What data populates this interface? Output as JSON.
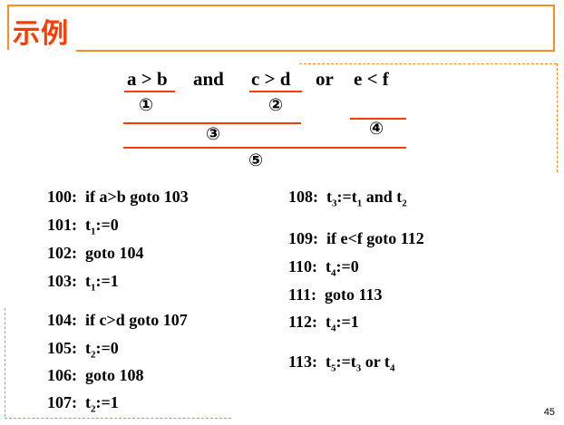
{
  "title": "示例",
  "expression": {
    "a": "a > b",
    "and": "and",
    "c": "c > d",
    "or": "or",
    "e": "e < f"
  },
  "markers": [
    "①",
    "②",
    "③",
    "④",
    "⑤"
  ],
  "code_left": [
    {
      "label": "100:",
      "text": "if  a>b  goto  103"
    },
    {
      "label": "101:",
      "pre": "t",
      "sub": "1",
      "post": ":=0"
    },
    {
      "label": "102:",
      "text": "goto  104"
    },
    {
      "label": "103:",
      "pre": "t",
      "sub": "1",
      "post": ":=1"
    },
    {
      "label": "104:",
      "text": "if  c>d  goto  107"
    },
    {
      "label": "105:",
      "pre": "t",
      "sub": "2",
      "post": ":=0"
    },
    {
      "label": "106:",
      "text": "goto  108"
    },
    {
      "label": "107:",
      "pre": "t",
      "sub": "2",
      "post": ":=1"
    }
  ],
  "code_right": [
    {
      "label": "108:",
      "t1": "t",
      "s1": "3",
      "m1": ":=t",
      "s2": "1",
      "m2": " and t",
      "s3": "2"
    },
    {
      "label": "109:",
      "text": "if  e<f  goto  112"
    },
    {
      "label": "110:",
      "pre": "t",
      "sub": "4",
      "post": ":=0"
    },
    {
      "label": "111:",
      "text": "goto  113"
    },
    {
      "label": "112:",
      "pre": "t",
      "sub": "4",
      "post": ":=1"
    },
    {
      "label": "113:",
      "t1": "t",
      "s1": "5",
      "m1": ":=t",
      "s2": "3",
      "m2": " or t",
      "s3": "4"
    }
  ],
  "page_number": "45",
  "colors": {
    "accent": "#ff8a1f",
    "title": "#ff3b00",
    "underline": "#ff3b00"
  }
}
